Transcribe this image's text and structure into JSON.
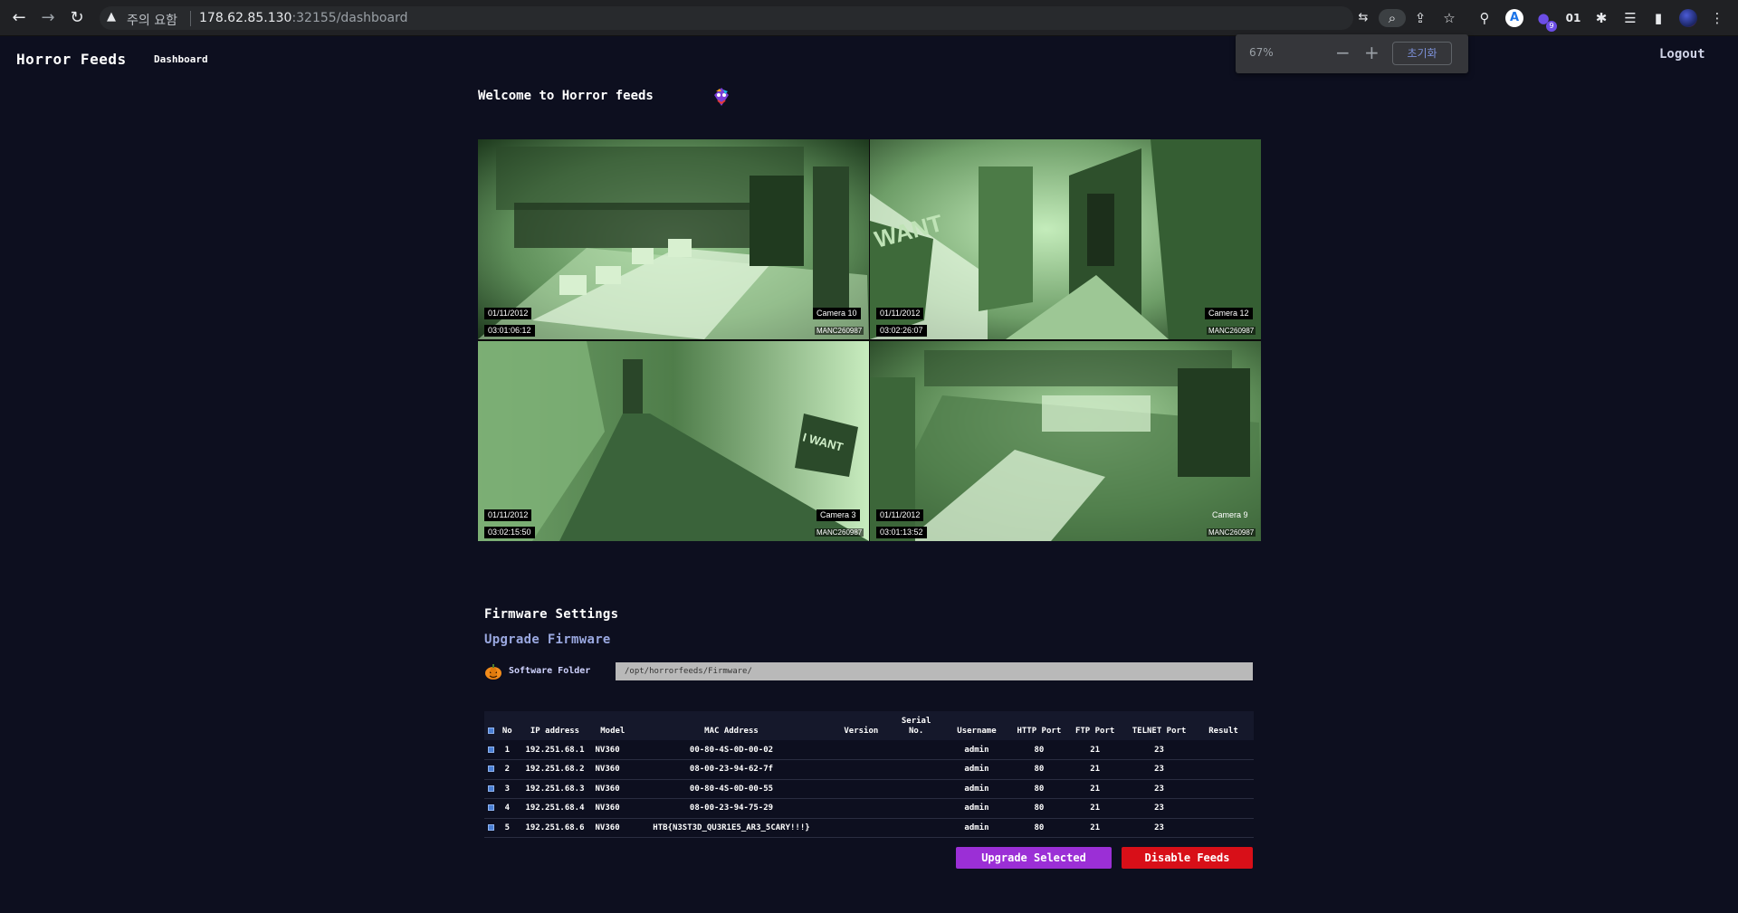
{
  "browser": {
    "security_warning": "주의 요함",
    "url_host": "178.62.85.130",
    "url_rest": ":32155/dashboard",
    "zoom_percent": "67%",
    "zoom_minus": "−",
    "zoom_plus": "+",
    "zoom_reset": "초기화",
    "profile_letter": "A",
    "extension_badge": "9",
    "extension_text": "01"
  },
  "header": {
    "brand": "Horror Feeds",
    "nav_dashboard": "Dashboard",
    "logout": "Logout"
  },
  "main": {
    "welcome": "Welcome to Horror feeds"
  },
  "cameras": [
    {
      "date": "01/11/2012",
      "time": "03:01:06:12",
      "name": "Camera 10",
      "id": "MANC260987"
    },
    {
      "date": "01/11/2012",
      "time": "03:02:26:07",
      "name": "Camera 12",
      "id": "MANC260987"
    },
    {
      "date": "01/11/2012",
      "time": "03:02:15:50",
      "name": "Camera 3",
      "id": "MANC260987"
    },
    {
      "date": "01/11/2012",
      "time": "03:01:13:52",
      "name": "Camera 9",
      "id": "MANC260987"
    }
  ],
  "firmware": {
    "title": "Firmware Settings",
    "subtitle": "Upgrade Firmware",
    "folder_label": "Software Folder",
    "folder_value": "/opt/horrorfeeds/Firmware/",
    "columns": [
      "No",
      "IP address",
      "Model",
      "MAC Address",
      "Version",
      "Serial No.",
      "Username",
      "HTTP Port",
      "FTP Port",
      "TELNET Port",
      "Result"
    ],
    "rows": [
      {
        "no": "1",
        "ip": "192.251.68.1",
        "model": "NV360",
        "mac": "00-80-4S-0D-00-02",
        "version": "",
        "serial": "",
        "user": "admin",
        "http": "80",
        "ftp": "21",
        "telnet": "23",
        "result": ""
      },
      {
        "no": "2",
        "ip": "192.251.68.2",
        "model": "NV360",
        "mac": "08-00-23-94-62-7f",
        "version": "",
        "serial": "",
        "user": "admin",
        "http": "80",
        "ftp": "21",
        "telnet": "23",
        "result": ""
      },
      {
        "no": "3",
        "ip": "192.251.68.3",
        "model": "NV360",
        "mac": "00-80-4S-0D-00-55",
        "version": "",
        "serial": "",
        "user": "admin",
        "http": "80",
        "ftp": "21",
        "telnet": "23",
        "result": ""
      },
      {
        "no": "4",
        "ip": "192.251.68.4",
        "model": "NV360",
        "mac": "08-00-23-94-75-29",
        "version": "",
        "serial": "",
        "user": "admin",
        "http": "80",
        "ftp": "21",
        "telnet": "23",
        "result": ""
      },
      {
        "no": "5",
        "ip": "192.251.68.6",
        "model": "NV360",
        "mac": "HTB{N3ST3D_QU3R1E5_AR3_5CARY!!!}",
        "version": "",
        "serial": "",
        "user": "admin",
        "http": "80",
        "ftp": "21",
        "telnet": "23",
        "result": ""
      }
    ],
    "upgrade_button": "Upgrade Selected",
    "disable_button": "Disable Feeds"
  },
  "colors": {
    "background": "#0d0f1f",
    "accent_purple": "#9b2fd6",
    "accent_red": "#d80f18",
    "subtitle_blue": "#9aa8e0",
    "night_vision_green": "#5f8f5a"
  }
}
